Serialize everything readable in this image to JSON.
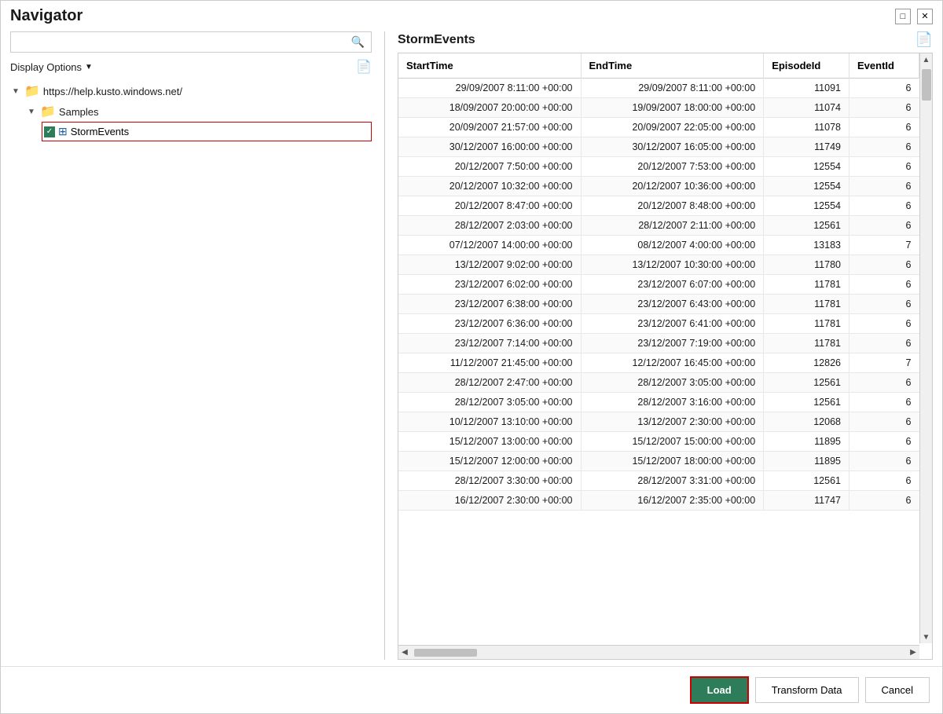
{
  "window": {
    "title": "Navigator",
    "min_label": "□",
    "close_label": "✕"
  },
  "left": {
    "search_placeholder": "",
    "display_options_label": "Display Options",
    "display_options_arrow": "▼",
    "tree": {
      "root_url": "https://help.kusto.windows.net/",
      "samples_label": "Samples",
      "selected_item_label": "StormEvents"
    }
  },
  "right": {
    "title": "StormEvents",
    "columns": [
      "StartTime",
      "EndTime",
      "EpisodeId",
      "EventId"
    ],
    "rows": [
      [
        "29/09/2007 8:11:00 +00:00",
        "29/09/2007 8:11:00 +00:00",
        "11091",
        "6"
      ],
      [
        "18/09/2007 20:00:00 +00:00",
        "19/09/2007 18:00:00 +00:00",
        "11074",
        "6"
      ],
      [
        "20/09/2007 21:57:00 +00:00",
        "20/09/2007 22:05:00 +00:00",
        "11078",
        "6"
      ],
      [
        "30/12/2007 16:00:00 +00:00",
        "30/12/2007 16:05:00 +00:00",
        "11749",
        "6"
      ],
      [
        "20/12/2007 7:50:00 +00:00",
        "20/12/2007 7:53:00 +00:00",
        "12554",
        "6"
      ],
      [
        "20/12/2007 10:32:00 +00:00",
        "20/12/2007 10:36:00 +00:00",
        "12554",
        "6"
      ],
      [
        "20/12/2007 8:47:00 +00:00",
        "20/12/2007 8:48:00 +00:00",
        "12554",
        "6"
      ],
      [
        "28/12/2007 2:03:00 +00:00",
        "28/12/2007 2:11:00 +00:00",
        "12561",
        "6"
      ],
      [
        "07/12/2007 14:00:00 +00:00",
        "08/12/2007 4:00:00 +00:00",
        "13183",
        "7"
      ],
      [
        "13/12/2007 9:02:00 +00:00",
        "13/12/2007 10:30:00 +00:00",
        "11780",
        "6"
      ],
      [
        "23/12/2007 6:02:00 +00:00",
        "23/12/2007 6:07:00 +00:00",
        "11781",
        "6"
      ],
      [
        "23/12/2007 6:38:00 +00:00",
        "23/12/2007 6:43:00 +00:00",
        "11781",
        "6"
      ],
      [
        "23/12/2007 6:36:00 +00:00",
        "23/12/2007 6:41:00 +00:00",
        "11781",
        "6"
      ],
      [
        "23/12/2007 7:14:00 +00:00",
        "23/12/2007 7:19:00 +00:00",
        "11781",
        "6"
      ],
      [
        "11/12/2007 21:45:00 +00:00",
        "12/12/2007 16:45:00 +00:00",
        "12826",
        "7"
      ],
      [
        "28/12/2007 2:47:00 +00:00",
        "28/12/2007 3:05:00 +00:00",
        "12561",
        "6"
      ],
      [
        "28/12/2007 3:05:00 +00:00",
        "28/12/2007 3:16:00 +00:00",
        "12561",
        "6"
      ],
      [
        "10/12/2007 13:10:00 +00:00",
        "13/12/2007 2:30:00 +00:00",
        "12068",
        "6"
      ],
      [
        "15/12/2007 13:00:00 +00:00",
        "15/12/2007 15:00:00 +00:00",
        "11895",
        "6"
      ],
      [
        "15/12/2007 12:00:00 +00:00",
        "15/12/2007 18:00:00 +00:00",
        "11895",
        "6"
      ],
      [
        "28/12/2007 3:30:00 +00:00",
        "28/12/2007 3:31:00 +00:00",
        "12561",
        "6"
      ],
      [
        "16/12/2007 2:30:00 +00:00",
        "16/12/2007 2:35:00 +00:00",
        "11747",
        "6"
      ]
    ]
  },
  "footer": {
    "load_label": "Load",
    "transform_label": "Transform Data",
    "cancel_label": "Cancel"
  }
}
